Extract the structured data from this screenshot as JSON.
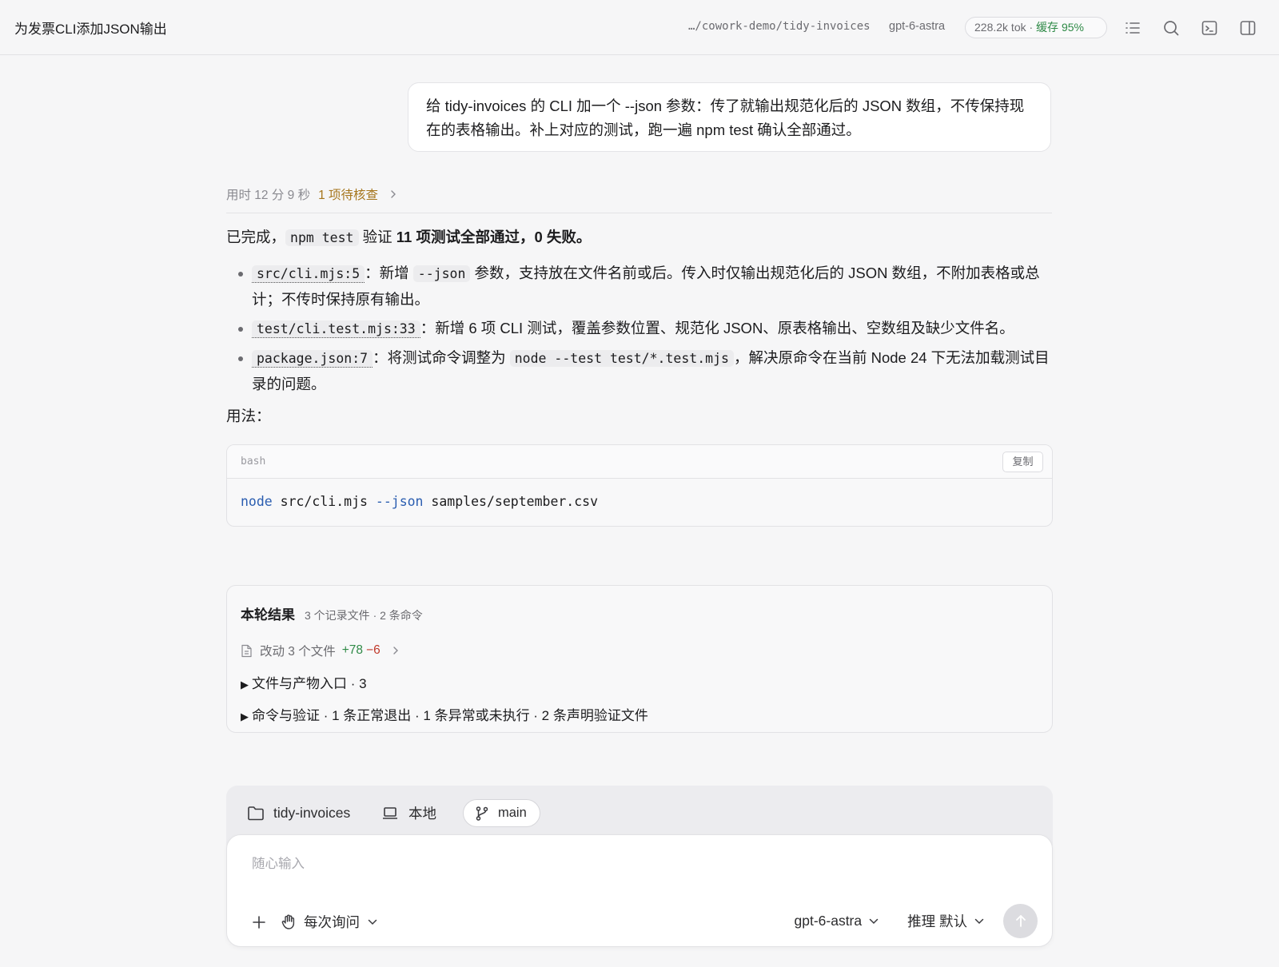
{
  "header": {
    "title": "为发票CLI添加JSON输出",
    "path": "…/cowork-demo/tidy-invoices",
    "model": "gpt-6-astra",
    "tokens": "228.2k tok",
    "separator": " · ",
    "cache": "缓存 95%",
    "icons": [
      "list-icon",
      "search-icon",
      "terminal-icon",
      "sidebar-toggle-icon"
    ]
  },
  "user_message": {
    "text": "给 tidy-invoices 的 CLI 加一个 --json 参数：传了就输出规范化后的 JSON 数组，不传保持现在的表格输出。补上对应的测试，跑一遍 npm test 确认全部通过。"
  },
  "meta": {
    "duration": "用时 12 分 9 秒",
    "pending": "1 项待核查"
  },
  "answer": {
    "lead_prefix": "已完成，",
    "lead_code": "npm test",
    "lead_mid": " 验证 ",
    "lead_bold": "11 项测试全部通过，0 失败。",
    "bullets": [
      {
        "file": "src/cli.mjs:5",
        "text1": "：新增 ",
        "code": "--json",
        "text2": " 参数，支持放在文件名前或后。传入时仅输出规范化后的 JSON 数组，不附加表格或总计；不传时保持原有输出。"
      },
      {
        "file": "test/cli.test.mjs:33",
        "text1": "：新增 6 项 CLI 测试，覆盖参数位置、规范化 JSON、原表格输出、空数组及缺少文件名。"
      },
      {
        "file": "package.json:7",
        "text1": "：将测试命令调整为 ",
        "code": "node --test test/*.test.mjs",
        "text2": "，解决原命令在当前 Node 24 下无法加载测试目录的问题。"
      }
    ],
    "usage_label": "用法："
  },
  "codeblock": {
    "lang": "bash",
    "copy_label": "复制",
    "cmd": "node",
    "arg1": " src/cli.mjs ",
    "flag": "--json",
    "arg2": " samples/september.csv"
  },
  "result": {
    "title": "本轮结果",
    "subtitle": "3 个记录文件 · 2 条命令",
    "changes_label": "改动 3 个文件",
    "additions": "+78",
    "deletions": "−6",
    "section1": "文件与产物入口 · 3",
    "section2": "命令与验证 · 1 条正常退出 · 1 条异常或未执行 · 2 条声明验证文件"
  },
  "composer": {
    "folder": "tidy-invoices",
    "location": "本地",
    "branch": "main",
    "placeholder": "随心输入",
    "permission": "每次询问",
    "model": "gpt-6-astra",
    "reasoning": "推理 默认"
  }
}
